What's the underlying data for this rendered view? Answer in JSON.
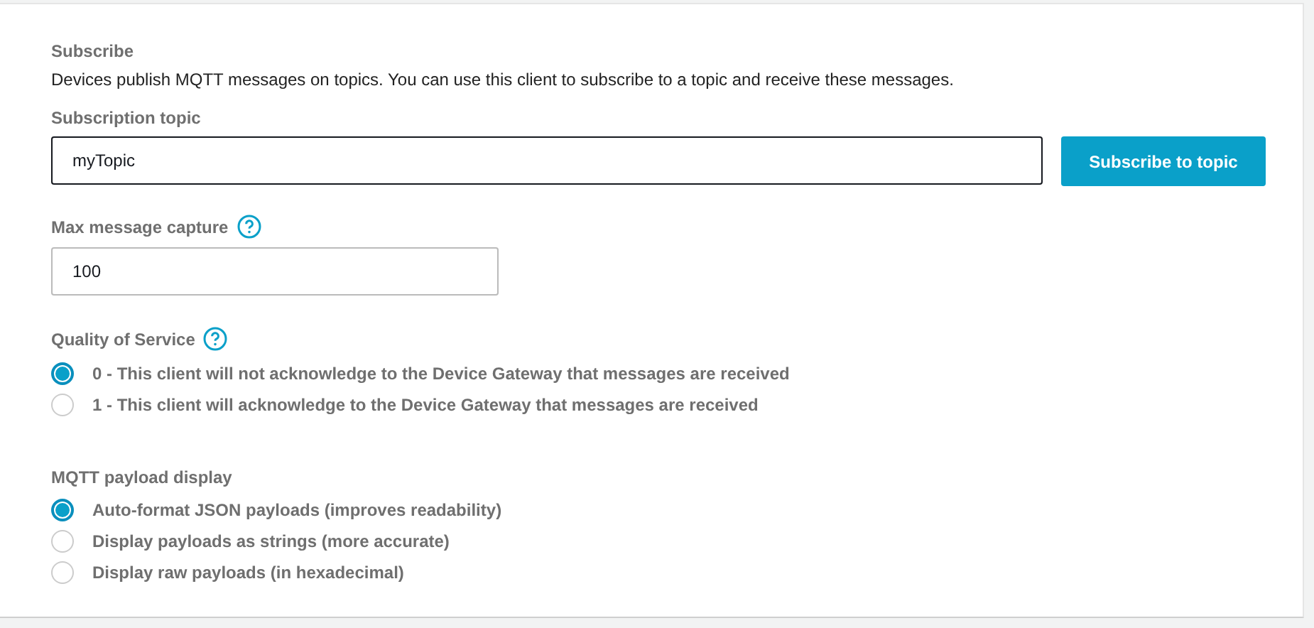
{
  "section_title": "Subscribe",
  "description": "Devices publish MQTT messages on topics. You can use this client to subscribe to a topic and receive these messages.",
  "subscription_topic": {
    "label": "Subscription topic",
    "value": "myTopic"
  },
  "subscribe_button": "Subscribe to topic",
  "max_message_capture": {
    "label": "Max message capture",
    "value": "100"
  },
  "quality_of_service": {
    "label": "Quality of Service",
    "options": [
      {
        "label": "0 - This client will not acknowledge to the Device Gateway that messages are received",
        "selected": true
      },
      {
        "label": "1 - This client will acknowledge to the Device Gateway that messages are received",
        "selected": false
      }
    ]
  },
  "payload_display": {
    "label": "MQTT payload display",
    "options": [
      {
        "label": "Auto-format JSON payloads (improves readability)",
        "selected": true
      },
      {
        "label": "Display payloads as strings (more accurate)",
        "selected": false
      },
      {
        "label": "Display raw payloads (in hexadecimal)",
        "selected": false
      }
    ]
  }
}
